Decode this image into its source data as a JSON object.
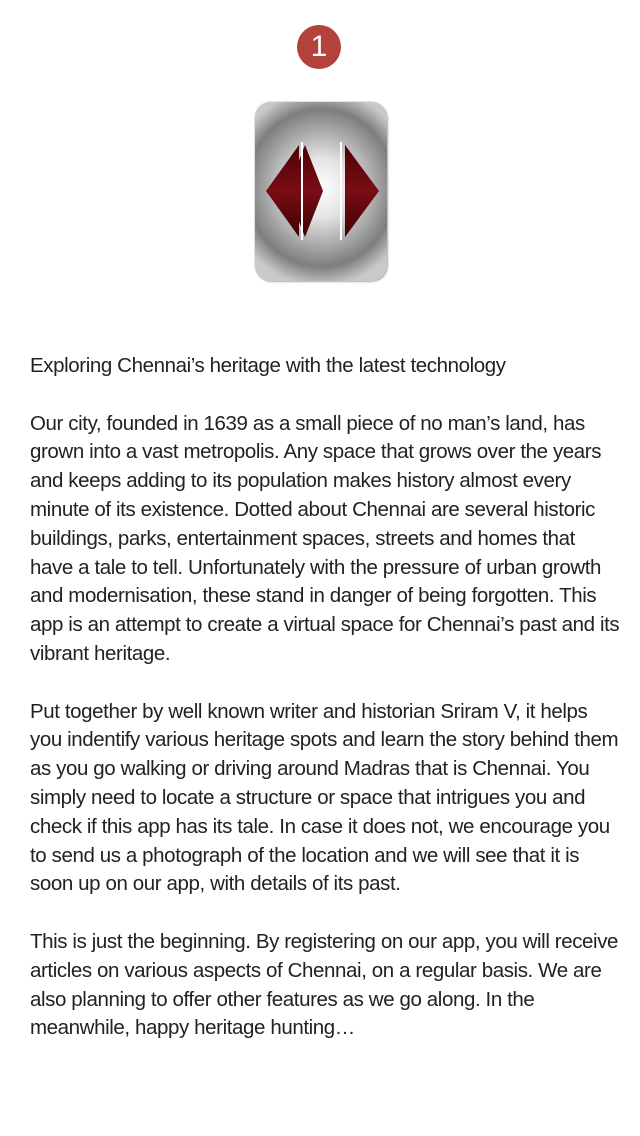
{
  "page_badge": {
    "number": "1",
    "color": "#b3423a"
  },
  "logo": {
    "icon": "heritage-diamond-logo-icon",
    "accent": "#6a0a10"
  },
  "content": {
    "headline": "Exploring Chennai’s heritage with the latest technology",
    "paragraphs": [
      "Our city, founded in 1639 as a small piece of no man’s land, has grown into a vast metropolis. Any space that grows over the years and keeps adding to its population makes history almost every minute of its exis­tence. Dotted about Chennai are several historic buildings, parks, enter­tainment spaces, streets and homes that have a tale to tell. Unfortunately with the pressure of urban growth and modernisation, these stand in danger of being forgotten. This app is an attempt to create a virtual space for Chennai’s past and its vibrant heritage.",
      "Put together by well known writer and historian Sriram V, it helps you in­dentify various heritage spots and learn the story behind them as you go walking or driving around Madras that is Chennai. You simply need to locate a structure or space that intrigues you and check if this app has its tale. In case it does not, we encourage you to send us a photograph of the location and we will see that it is soon up on our app, with details of its past.",
      "This is just the beginning. By registering on our app, you will receive ar­ticles on various aspects of Chennai, on a regular basis. We are also planning to offer other features as we go along. In the meanwhile, happy heritage hunting…"
    ]
  }
}
